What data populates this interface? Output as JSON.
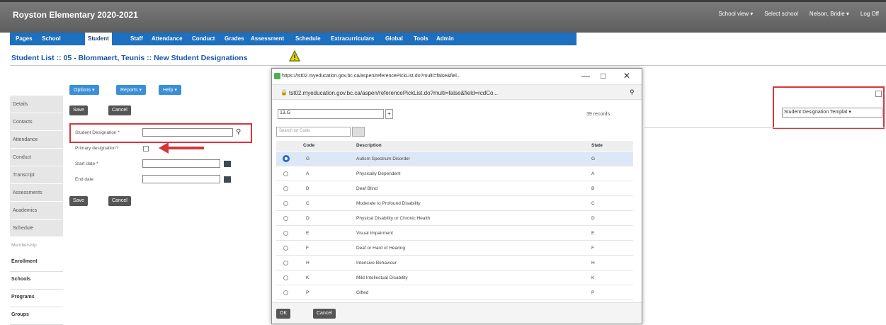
{
  "app": {
    "title": "Royston Elementary 2020-2021"
  },
  "topright": {
    "school_view": "School view ▾",
    "select_school": "Select school",
    "user": "Nelson, Bridie ▾",
    "logoff": "Log Off"
  },
  "nav": {
    "tabs": [
      "Pages",
      "School",
      "Student",
      "Staff",
      "Attendance",
      "Conduct",
      "Grades",
      "Assessment",
      "Schedule",
      "Extracurriculars",
      "Global",
      "Tools",
      "Admin"
    ],
    "active": "Student"
  },
  "breadcrumb": "Student List :: 05 - Blommaert, Teunis :: New Student Designations",
  "sidebar": {
    "items": [
      "Details",
      "Contacts",
      "Attendance",
      "Conduct",
      "Transcript",
      "Assessments",
      "Academics",
      "Schedule"
    ],
    "section_head": "Membership",
    "tabs": [
      "Enrollment",
      "Schools",
      "Programs",
      "Groups"
    ]
  },
  "toolbar": {
    "options": "Options ▾",
    "reports": "Reports ▾",
    "help": "Help ▾",
    "save": "Save",
    "cancel": "Cancel"
  },
  "form": {
    "designation_label": "Student Designation *",
    "primary_label": "Primary designation?",
    "start_label": "Start date *",
    "end_label": "End date"
  },
  "popup": {
    "title_url": "https://tst02.myeducation.gov.bc.ca/aspen/referencePickList.do?multi=false&fiel...",
    "address": "tst02.myeducation.gov.bc.ca/aspen/referencePickList.do?multi=false&field=rcdCo...",
    "filter": "13.G",
    "records": "39 records",
    "search_placeholder": "Search on Code",
    "headers": {
      "code": "Code",
      "description": "Description",
      "state": "State"
    },
    "rows": [
      {
        "code": "G",
        "description": "Autism Spectrum Disorder",
        "state": "G"
      },
      {
        "code": "A",
        "description": "Physically Dependent",
        "state": "A"
      },
      {
        "code": "B",
        "description": "Deaf Blind",
        "state": "B"
      },
      {
        "code": "C",
        "description": "Moderate to Profound Disability",
        "state": "C"
      },
      {
        "code": "D",
        "description": "Physical Disability or Chronic Health",
        "state": "D"
      },
      {
        "code": "E",
        "description": "Visual Impairment",
        "state": "E"
      },
      {
        "code": "F",
        "description": "Deaf or Hard of Hearing",
        "state": "F"
      },
      {
        "code": "H",
        "description": "Intensive Behaviour",
        "state": "H"
      },
      {
        "code": "K",
        "description": "Mild Intellectual Disability",
        "state": "K"
      },
      {
        "code": "P",
        "description": "Gifted",
        "state": "P"
      }
    ],
    "ok": "OK",
    "cancel": "Cancel"
  },
  "template_select": "Student Designation Templat ▾",
  "colors": {
    "nav": "#1d6fbf",
    "highlight": "#d9343a",
    "link": "#1756a9"
  }
}
